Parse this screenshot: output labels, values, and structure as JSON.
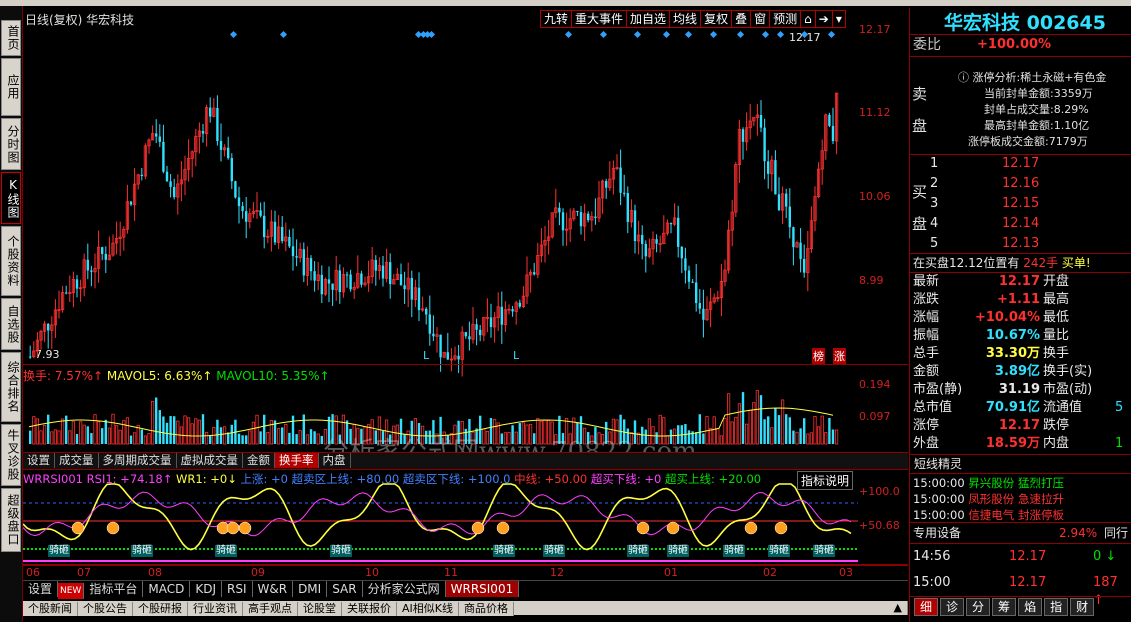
{
  "left_tabs": [
    "首页",
    "应用",
    "分时图",
    "K线图",
    "个股资料",
    "自选股",
    "综合排名",
    "牛叉诊股",
    "超级盘口"
  ],
  "chart_header": {
    "title": "日线(复权) 华宏科技"
  },
  "toolbar": [
    "九转",
    "重大事件",
    "加自选",
    "均线",
    "复权",
    "叠",
    "窗",
    "预测"
  ],
  "price_axis": [
    "12.17",
    "11.12",
    "10.06",
    "8.99"
  ],
  "price_marks": {
    "high": "12.17",
    "low": "7.93",
    "bang": "榜",
    "zhang": "涨",
    "L1": "L",
    "L2": "L"
  },
  "volume_header": {
    "hs": "换手: 7.57%↑",
    "mv5": "MAVOL5: 6.63%↑",
    "mv10": "MAVOL10: 5.35%↑"
  },
  "volume_axis": [
    "0.194",
    "0.097"
  ],
  "watermark": "分析家公式网www.70822.com",
  "mid_tabs": [
    "设置",
    "成交量",
    "多周期成交量",
    "虚拟成交量",
    "金额",
    "换手率",
    "内盘"
  ],
  "mid_active": 5,
  "indicator_header": {
    "name": "WRRSI001",
    "rsi": "RSI1: +74.18↑",
    "wr": "WR1: +0↓",
    "up": "上涨: +0",
    "cm1": "超卖区上线: +80.00",
    "cm2": "超卖区下线: +100.0",
    "mid": "中线: +50.00",
    "cm3": "超买下线: +0",
    "cm4": "超买上线: +20.00",
    "explain": "指标说明"
  },
  "indicator_axis": [
    "+100.0",
    "+50.68"
  ],
  "buy_label": "骑砸",
  "x_axis": [
    "06",
    "07",
    "08",
    "09",
    "10",
    "11",
    "12",
    "01",
    "02",
    "03"
  ],
  "bottom_tabs": [
    "设置",
    "NEW",
    "指标平台",
    "MACD",
    "KDJ",
    "RSI",
    "W&R",
    "DMI",
    "SAR",
    "分析家公式网",
    "WRRSI001"
  ],
  "news_tabs": [
    "个股新闻",
    "个股公告",
    "个股研报",
    "行业资讯",
    "高手观点",
    "论股堂",
    "关联报价",
    "AI相似K线",
    "商品价格"
  ],
  "stock": {
    "name": "华宏科技",
    "code": "002645"
  },
  "weibi": {
    "label": "委比",
    "value": "+100.00%"
  },
  "sell_label": "卖盘",
  "limit_info": {
    "title": "涨停分析:稀土永磁+有色金",
    "l1": "当前封单金额:3359万",
    "l2": "封单占成交量:8.29%",
    "l3": "最高封单金额:1.10亿",
    "l4": "涨停板成交金额:7179万"
  },
  "buy_label_side": "买盘",
  "bids": [
    {
      "n": "1",
      "p": "12.17"
    },
    {
      "n": "2",
      "p": "12.16"
    },
    {
      "n": "3",
      "p": "12.15"
    },
    {
      "n": "4",
      "p": "12.14"
    },
    {
      "n": "5",
      "p": "12.13"
    }
  ],
  "bid_note": {
    "text": "在买盘12.12位置有",
    "qty": "242手",
    "tail": "买单!"
  },
  "quote": [
    {
      "k": "最新",
      "v": "12.17",
      "k2": "开盘",
      "c": "red"
    },
    {
      "k": "涨跌",
      "v": "+1.11",
      "k2": "最高",
      "c": "red"
    },
    {
      "k": "涨幅",
      "v": "+10.04%",
      "k2": "最低",
      "c": "red"
    },
    {
      "k": "振幅",
      "v": "10.67%",
      "k2": "量比",
      "c": "cyan"
    },
    {
      "k": "总手",
      "v": "33.30万",
      "k2": "换手",
      "c": "yellow"
    },
    {
      "k": "金额",
      "v": "3.89亿",
      "k2": "换手(实)",
      "c": "cyan"
    },
    {
      "k": "市盈(静)",
      "v": "31.19",
      "k2": "市盈(动)",
      "c": "white"
    },
    {
      "k": "总市值",
      "v": "70.91亿",
      "k2": "流通值",
      "c": "cyan"
    },
    {
      "k": "涨停",
      "v": "12.17",
      "k2": "跌停",
      "c": "red"
    },
    {
      "k": "外盘",
      "v": "18.59万",
      "k2": "内盘",
      "c": "red"
    }
  ],
  "quote_tail": {
    "liutong": "5",
    "neipan": "1"
  },
  "jingling": {
    "title": "短线精灵",
    "rows": [
      {
        "t": "15:00:00",
        "n": "昇兴股份",
        "e": "猛烈打压",
        "c": "green"
      },
      {
        "t": "15:00:00",
        "n": "凤形股份",
        "e": "急速拉升",
        "c": "red"
      },
      {
        "t": "15:00:00",
        "n": "信捷电气",
        "e": "封涨停板",
        "c": "red"
      }
    ]
  },
  "industry": {
    "name": "专用设备",
    "pct": "2.94%",
    "tag": "同行"
  },
  "ticks": [
    {
      "t": "14:56",
      "p": "12.17",
      "v": "0",
      "arrow": "↓",
      "c": "green"
    },
    {
      "t": "15:00",
      "p": "12.17",
      "v": "187",
      "arrow": "↑",
      "c": "red"
    }
  ],
  "right_bottom_tabs": [
    "细",
    "诊",
    "分",
    "筹",
    "焰",
    "指",
    "财"
  ],
  "colors": {
    "up": "#ff3030",
    "down": "#30e0ff",
    "axis": "#8b0000"
  }
}
